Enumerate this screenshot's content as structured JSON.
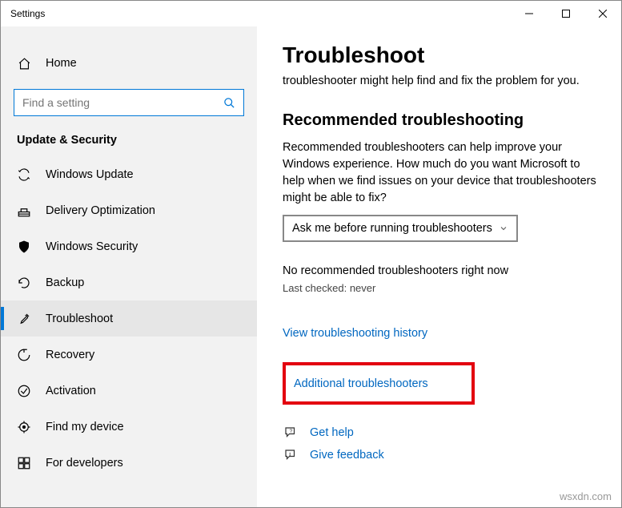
{
  "titlebar": {
    "title": "Settings"
  },
  "sidebar": {
    "home": "Home",
    "search_placeholder": "Find a setting",
    "section": "Update & Security",
    "items": [
      {
        "label": "Windows Update"
      },
      {
        "label": "Delivery Optimization"
      },
      {
        "label": "Windows Security"
      },
      {
        "label": "Backup"
      },
      {
        "label": "Troubleshoot"
      },
      {
        "label": "Recovery"
      },
      {
        "label": "Activation"
      },
      {
        "label": "Find my device"
      },
      {
        "label": "For developers"
      }
    ]
  },
  "main": {
    "title": "Troubleshoot",
    "intro": "troubleshooter might help find and fix the problem for you.",
    "rec_heading": "Recommended troubleshooting",
    "rec_text": "Recommended troubleshooters can help improve your Windows experience. How much do you want Microsoft to help when we find issues on your device that troubleshooters might be able to fix?",
    "dropdown_value": "Ask me before running troubleshooters",
    "status": "No recommended troubleshooters right now",
    "last_checked": "Last checked: never",
    "history_link": "View troubleshooting history",
    "additional_link": "Additional troubleshooters",
    "get_help": "Get help",
    "give_feedback": "Give feedback"
  },
  "watermark": "wsxdn.com"
}
